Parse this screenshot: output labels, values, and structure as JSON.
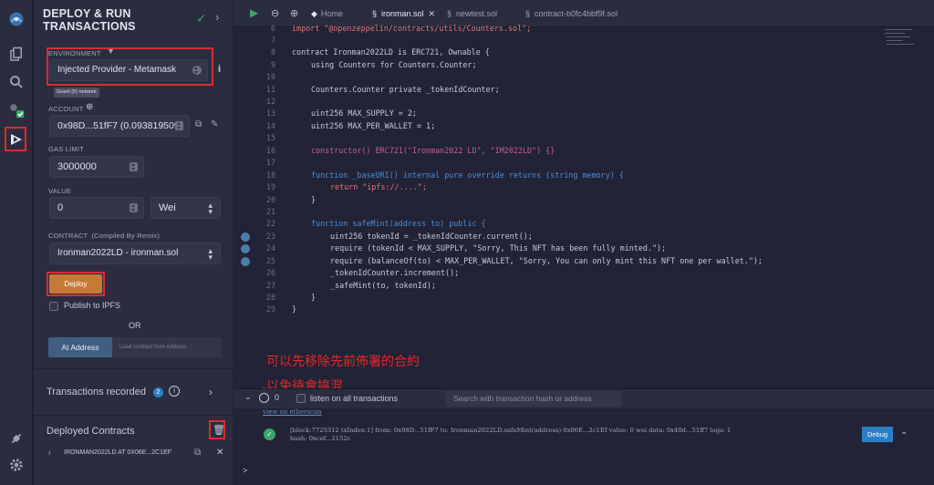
{
  "rail": {
    "items": [
      "home",
      "file-explorer",
      "search",
      "compiler",
      "deploy-run"
    ]
  },
  "panel": {
    "title_line1": "DEPLOY & RUN",
    "title_line2": "TRANSACTIONS",
    "environment_label": "ENVIRONMENT",
    "environment_value": "Injected Provider - Metamask",
    "network_badge": "Goerli (5) network",
    "account_label": "ACCOUNT",
    "account_value": "0x98D...51fF7 (0.093819509",
    "gas_limit_label": "GAS LIMIT",
    "gas_limit_value": "3000000",
    "value_label": "VALUE",
    "value_amount": "0",
    "value_unit": "Wei",
    "contract_label": "CONTRACT",
    "contract_sublabel": "(Compiled By Remix)",
    "contract_value": "Ironman2022LD - ironman.sol",
    "deploy_label": "Deploy",
    "publish_label": "Publish to IPFS",
    "or_label": "OR",
    "at_address_label": "At Address",
    "load_contract_placeholder": "Load contract from Address",
    "transactions_recorded_label": "Transactions recorded",
    "transactions_recorded_count": "2",
    "deployed_contracts_label": "Deployed Contracts",
    "deployed_item": "IRONMAN2022LD AT 0X06E...2C1EF"
  },
  "tabs": [
    {
      "label": "Home",
      "active": false
    },
    {
      "label": "ironman.sol",
      "active": true
    },
    {
      "label": "newtest.sol",
      "active": false
    },
    {
      "label": "contract-b0fc4bbf9f.sol",
      "active": false
    }
  ],
  "editor": {
    "line6": "import \"@openzeppelin/contracts/utils/Counters.sol\";",
    "line8_a": "contract Ironman2022LD is ERC721, Ownable {",
    "line9_a": "using Counters for Counters.Counter;",
    "line11_a": "Counters.Counter private _tokenIdCounter;",
    "line13_a": "uint256 MAX_SUPPLY = 2;",
    "line14_a": "uint256 MAX_PER_WALLET = 1;",
    "line16_a": "constructor() ERC721(\"Ironman2022 LD\", \"IM2022LD\") {}",
    "line18_a": "function _baseURI() internal pure override returns (string memory) {",
    "line19_a": "return \"ipfs://....\";",
    "line20_a": "}",
    "line22_a": "function safeMint(address to) public {",
    "line23_a": "uint256 tokenId = _tokenIdCounter.current();",
    "line24_a": "require (tokenId < MAX_SUPPLY, \"Sorry, This NFT has been fully minted.\");",
    "line25_a": "require (balanceOf(to) < MAX_PER_WALLET, \"Sorry, You can only mint this NFT one per wallet.\");",
    "line26_a": "_tokenIdCounter.increment();",
    "line27_a": "_safeMint(to, tokenId);",
    "line28_a": "}",
    "line29_a": "}"
  },
  "terminal": {
    "count": "0",
    "listen_label": "listen on all transactions",
    "search_placeholder": "Search with transaction hash or address",
    "view_link": "view on etherscan",
    "tx_line1": "[block:7725312 txIndex:1] from: 0x98D...51fF7 to: Ironman2022LD.safeMint(address) 0x06E...2c1Ef value: 0 wei data: 0x40d...51ff7 logs: 1",
    "tx_line2": "hash: 0xcef...2152c",
    "debug_label": "Debug",
    "prompt": ">"
  },
  "annotation": {
    "line1": "可以先移除先前佈署的合約",
    "line2": "以免待會搞混"
  },
  "colors": {
    "highlight_red": "#e02a2a",
    "deploy_orange": "#c67a37",
    "debug_blue": "#2d7ec4",
    "success_green": "#3aa66a"
  }
}
